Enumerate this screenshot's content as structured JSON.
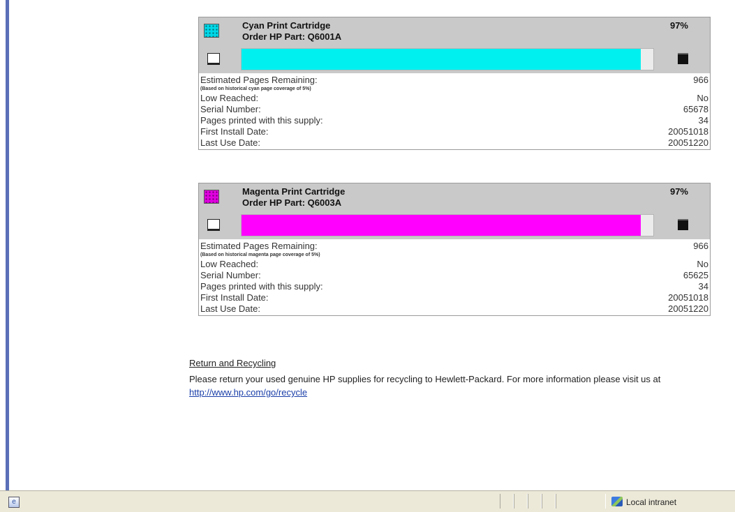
{
  "cartridges": [
    {
      "title": "Cyan Print Cartridge",
      "part": "Order HP Part:  Q6001A",
      "percent_label": "97%",
      "level": 0.97,
      "color": "#00f0f0",
      "note": "(Based on historical cyan page coverage of 5%)",
      "rows": [
        {
          "label": "Estimated Pages Remaining:",
          "value": "966"
        },
        {
          "label": "Low Reached:",
          "value": "No"
        },
        {
          "label": "Serial Number:",
          "value": "65678"
        },
        {
          "label": "Pages printed with this supply:",
          "value": "34"
        },
        {
          "label": "First Install Date:",
          "value": "20051018"
        },
        {
          "label": "Last Use Date:",
          "value": "20051220"
        }
      ]
    },
    {
      "title": "Magenta Print Cartridge",
      "part": "Order HP Part:  Q6003A",
      "percent_label": "97%",
      "level": 0.97,
      "color": "#ff00ff",
      "note": "(Based on historical magenta page coverage of 5%)",
      "rows": [
        {
          "label": "Estimated Pages Remaining:",
          "value": "966"
        },
        {
          "label": "Low Reached:",
          "value": "No"
        },
        {
          "label": "Serial Number:",
          "value": "65625"
        },
        {
          "label": "Pages printed with this supply:",
          "value": "34"
        },
        {
          "label": "First Install Date:",
          "value": "20051018"
        },
        {
          "label": "Last Use Date:",
          "value": "20051220"
        }
      ]
    }
  ],
  "recycling": {
    "heading": "Return and Recycling",
    "text": "Please return your used genuine HP supplies for recycling to Hewlett-Packard. For more information please visit us at",
    "link": "http://www.hp.com/go/recycle"
  },
  "statusbar": {
    "zone": "Local intranet"
  },
  "icons": {
    "cartridge": "ink-cartridge-icon",
    "empty": "empty-level-icon",
    "full": "full-level-icon",
    "page": "page-icon",
    "zone": "local-intranet-icon"
  }
}
